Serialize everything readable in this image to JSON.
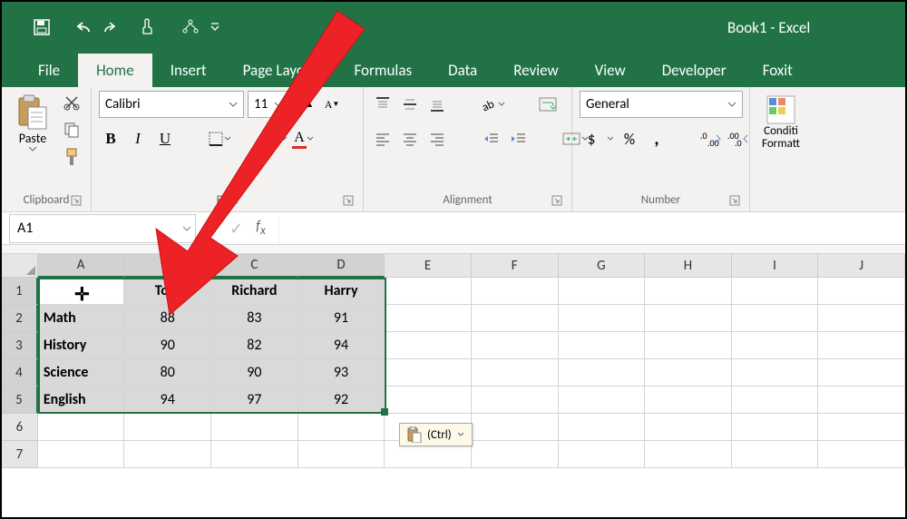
{
  "app_title": "Book1 - Excel",
  "tabs": [
    "File",
    "Home",
    "Insert",
    "Page Layout",
    "Formulas",
    "Data",
    "Review",
    "View",
    "Developer",
    "Foxit"
  ],
  "active_tab": 1,
  "ribbon": {
    "clipboard": {
      "label": "Clipboard",
      "paste": "Paste"
    },
    "font": {
      "label": "Font",
      "name": "Calibri",
      "size": "11",
      "bold": "B",
      "italic": "I",
      "underline": "U"
    },
    "alignment": {
      "label": "Alignment"
    },
    "number": {
      "label": "Number",
      "format": "General"
    },
    "styles": {
      "cond": "Conditional Formatting"
    }
  },
  "namebox": "A1",
  "columns": [
    "A",
    "B",
    "C",
    "D",
    "E",
    "F",
    "G",
    "H",
    "I",
    "J"
  ],
  "sel_cols": 4,
  "rows": 7,
  "sel_rows": 5,
  "table": {
    "headers": [
      "",
      "Tom",
      "Richard",
      "Harry"
    ],
    "rows": [
      [
        "Math",
        88,
        83,
        91
      ],
      [
        "History",
        90,
        82,
        94
      ],
      [
        "Science",
        80,
        90,
        93
      ],
      [
        "English",
        94,
        97,
        92
      ]
    ]
  },
  "paste_options": "(Ctrl)"
}
